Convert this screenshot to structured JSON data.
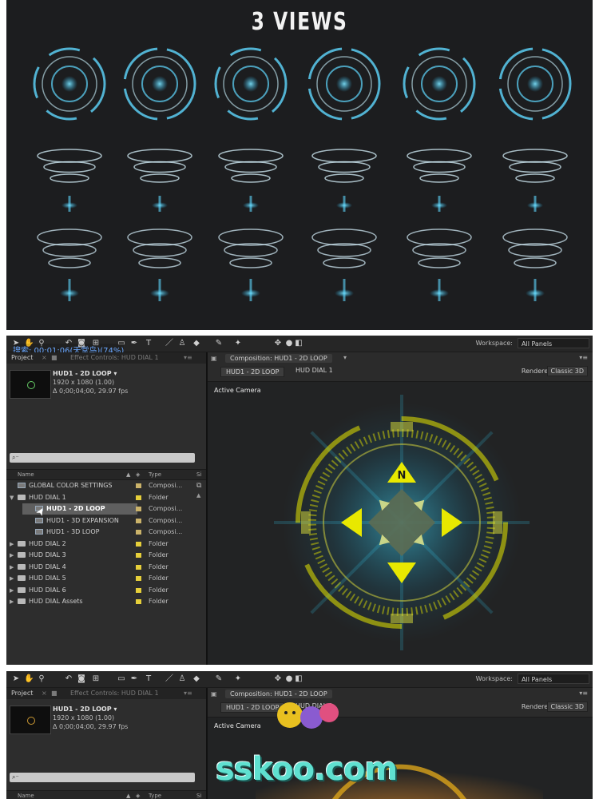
{
  "promo": {
    "title": "3 VIEWS",
    "accent": "#5fd8ff"
  },
  "toolbar": {
    "tools": [
      "selection-tool",
      "hand-tool",
      "zoom-tool",
      "rotate-tool",
      "camera-tool",
      "pan-behind-tool",
      "rectangle-tool",
      "pen-tool",
      "type-tool",
      "brush-tool",
      "clone-stamp-tool",
      "eraser-tool",
      "roto-brush-tool",
      "puppet-pin-tool"
    ],
    "workspace_label": "Workspace:",
    "workspace_value": "All Panels"
  },
  "overlay": {
    "search_text": "搜索: 00:01:06(天堂鸟)(74%)"
  },
  "project_panel": {
    "tab_project": "Project",
    "tab_effects": "Effect Controls: HUD DIAL 1",
    "comp_name": "HUD1 - 2D LOOP ▾",
    "comp_res": "1920 x 1080 (1.00)",
    "comp_dur": "Δ 0;00;04;00, 29.97 fps",
    "search_placeholder": "⌕⁻",
    "col_name": "Name",
    "col_type": "Type",
    "col_size": "Si",
    "items": [
      {
        "name": "GLOBAL COLOR SETTINGS",
        "type": "Composi...",
        "kind": "comp",
        "indent": 0,
        "expanded": false
      },
      {
        "name": "HUD DIAL 1",
        "type": "Folder",
        "kind": "folder",
        "indent": 0,
        "expanded": true
      },
      {
        "name": "HUD1 - 2D LOOP",
        "type": "Composi...",
        "kind": "comp",
        "indent": 1,
        "selected": true
      },
      {
        "name": "HUD1 - 3D EXPANSION",
        "type": "Composi...",
        "kind": "comp",
        "indent": 1
      },
      {
        "name": "HUD1 - 3D LOOP",
        "type": "Composi...",
        "kind": "comp",
        "indent": 1
      },
      {
        "name": "HUD DIAL 2",
        "type": "Folder",
        "kind": "folder",
        "indent": 0
      },
      {
        "name": "HUD DIAL 3",
        "type": "Folder",
        "kind": "folder",
        "indent": 0
      },
      {
        "name": "HUD DIAL 4",
        "type": "Folder",
        "kind": "folder",
        "indent": 0
      },
      {
        "name": "HUD DIAL 5",
        "type": "Folder",
        "kind": "folder",
        "indent": 0
      },
      {
        "name": "HUD DIAL 6",
        "type": "Folder",
        "kind": "folder",
        "indent": 0
      },
      {
        "name": "HUD DIAL Assets",
        "type": "Folder",
        "kind": "folder",
        "indent": 0
      }
    ]
  },
  "comp_panel": {
    "tab": "Composition: HUD1 - 2D LOOP",
    "crumb1": "HUD1 - 2D LOOP",
    "crumb2": "HUD DIAL 1",
    "renderer_label": "Renderer:",
    "renderer_value": "Classic 3D",
    "view_label": "Active Camera",
    "compass_letter": "N"
  },
  "project_panel_2": {
    "tab_project": "Project",
    "tab_effects": "Effect Controls: HUD DIAL 1",
    "comp_name": "HUD1 - 2D LOOP ▾",
    "comp_res": "1920 x 1080 (1.00)",
    "comp_dur": "Δ 0;00;04;00, 29.97 fps",
    "col_name": "Name",
    "col_type": "Type",
    "col_size": "Si"
  },
  "watermark": {
    "text": "sskoo.com"
  },
  "colors": {
    "hud_yellow": "#e8e800",
    "hud_cyan": "#35d7ff",
    "folder_swatch": "#e6cf3a"
  }
}
